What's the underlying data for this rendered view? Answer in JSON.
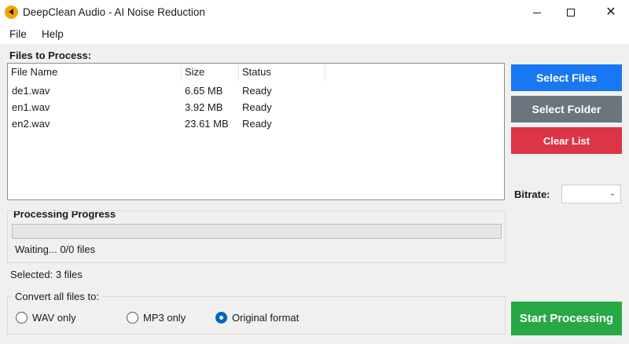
{
  "window": {
    "title": "DeepClean Audio - AI Noise Reduction"
  },
  "menu": {
    "items": [
      "File",
      "Help"
    ]
  },
  "files_panel": {
    "label": "Files to Process:",
    "columns": [
      "File Name",
      "Size",
      "Status"
    ],
    "rows": [
      {
        "name": "de1.wav",
        "size": "6.65 MB",
        "status": "Ready"
      },
      {
        "name": "en1.wav",
        "size": "3.92 MB",
        "status": "Ready"
      },
      {
        "name": "en2.wav",
        "size": "23.61 MB",
        "status": "Ready"
      }
    ]
  },
  "buttons": {
    "select_files": "Select Files",
    "select_folder": "Select Folder",
    "clear_list": "Clear List",
    "start": "Start Processing"
  },
  "bitrate": {
    "label": "Bitrate:",
    "value": ""
  },
  "progress": {
    "label": "Processing Progress",
    "status": "Waiting... 0/0 files",
    "fraction": 0
  },
  "selected_text": "Selected: 3 files",
  "convert": {
    "label": "Convert all files to:",
    "options": [
      "WAV only",
      "MP3 only",
      "Original format"
    ],
    "selected_index": 2
  },
  "colors": {
    "select_files": "#1877f2",
    "select_folder": "#6c757d",
    "clear_list": "#dc3545",
    "start": "#28a745",
    "radio_accent": "#0067c0"
  }
}
